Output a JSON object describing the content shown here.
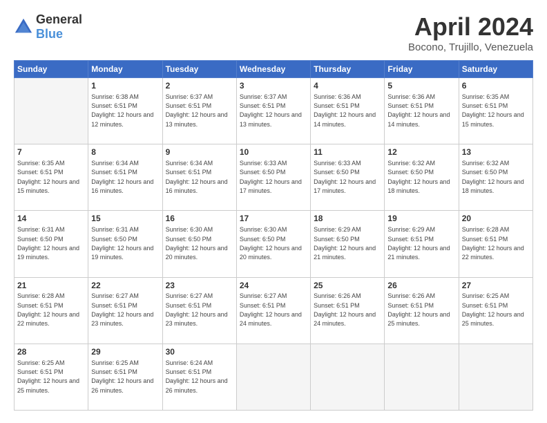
{
  "header": {
    "logo_general": "General",
    "logo_blue": "Blue",
    "title": "April 2024",
    "location": "Bocono, Trujillo, Venezuela"
  },
  "days_of_week": [
    "Sunday",
    "Monday",
    "Tuesday",
    "Wednesday",
    "Thursday",
    "Friday",
    "Saturday"
  ],
  "weeks": [
    [
      {
        "num": "",
        "empty": true
      },
      {
        "num": "1",
        "sunrise": "6:38 AM",
        "sunset": "6:51 PM",
        "daylight": "12 hours and 12 minutes."
      },
      {
        "num": "2",
        "sunrise": "6:37 AM",
        "sunset": "6:51 PM",
        "daylight": "12 hours and 13 minutes."
      },
      {
        "num": "3",
        "sunrise": "6:37 AM",
        "sunset": "6:51 PM",
        "daylight": "12 hours and 13 minutes."
      },
      {
        "num": "4",
        "sunrise": "6:36 AM",
        "sunset": "6:51 PM",
        "daylight": "12 hours and 14 minutes."
      },
      {
        "num": "5",
        "sunrise": "6:36 AM",
        "sunset": "6:51 PM",
        "daylight": "12 hours and 14 minutes."
      },
      {
        "num": "6",
        "sunrise": "6:35 AM",
        "sunset": "6:51 PM",
        "daylight": "12 hours and 15 minutes."
      }
    ],
    [
      {
        "num": "7",
        "sunrise": "6:35 AM",
        "sunset": "6:51 PM",
        "daylight": "12 hours and 15 minutes."
      },
      {
        "num": "8",
        "sunrise": "6:34 AM",
        "sunset": "6:51 PM",
        "daylight": "12 hours and 16 minutes."
      },
      {
        "num": "9",
        "sunrise": "6:34 AM",
        "sunset": "6:51 PM",
        "daylight": "12 hours and 16 minutes."
      },
      {
        "num": "10",
        "sunrise": "6:33 AM",
        "sunset": "6:50 PM",
        "daylight": "12 hours and 17 minutes."
      },
      {
        "num": "11",
        "sunrise": "6:33 AM",
        "sunset": "6:50 PM",
        "daylight": "12 hours and 17 minutes."
      },
      {
        "num": "12",
        "sunrise": "6:32 AM",
        "sunset": "6:50 PM",
        "daylight": "12 hours and 18 minutes."
      },
      {
        "num": "13",
        "sunrise": "6:32 AM",
        "sunset": "6:50 PM",
        "daylight": "12 hours and 18 minutes."
      }
    ],
    [
      {
        "num": "14",
        "sunrise": "6:31 AM",
        "sunset": "6:50 PM",
        "daylight": "12 hours and 19 minutes."
      },
      {
        "num": "15",
        "sunrise": "6:31 AM",
        "sunset": "6:50 PM",
        "daylight": "12 hours and 19 minutes."
      },
      {
        "num": "16",
        "sunrise": "6:30 AM",
        "sunset": "6:50 PM",
        "daylight": "12 hours and 20 minutes."
      },
      {
        "num": "17",
        "sunrise": "6:30 AM",
        "sunset": "6:50 PM",
        "daylight": "12 hours and 20 minutes."
      },
      {
        "num": "18",
        "sunrise": "6:29 AM",
        "sunset": "6:50 PM",
        "daylight": "12 hours and 21 minutes."
      },
      {
        "num": "19",
        "sunrise": "6:29 AM",
        "sunset": "6:51 PM",
        "daylight": "12 hours and 21 minutes."
      },
      {
        "num": "20",
        "sunrise": "6:28 AM",
        "sunset": "6:51 PM",
        "daylight": "12 hours and 22 minutes."
      }
    ],
    [
      {
        "num": "21",
        "sunrise": "6:28 AM",
        "sunset": "6:51 PM",
        "daylight": "12 hours and 22 minutes."
      },
      {
        "num": "22",
        "sunrise": "6:27 AM",
        "sunset": "6:51 PM",
        "daylight": "12 hours and 23 minutes."
      },
      {
        "num": "23",
        "sunrise": "6:27 AM",
        "sunset": "6:51 PM",
        "daylight": "12 hours and 23 minutes."
      },
      {
        "num": "24",
        "sunrise": "6:27 AM",
        "sunset": "6:51 PM",
        "daylight": "12 hours and 24 minutes."
      },
      {
        "num": "25",
        "sunrise": "6:26 AM",
        "sunset": "6:51 PM",
        "daylight": "12 hours and 24 minutes."
      },
      {
        "num": "26",
        "sunrise": "6:26 AM",
        "sunset": "6:51 PM",
        "daylight": "12 hours and 25 minutes."
      },
      {
        "num": "27",
        "sunrise": "6:25 AM",
        "sunset": "6:51 PM",
        "daylight": "12 hours and 25 minutes."
      }
    ],
    [
      {
        "num": "28",
        "sunrise": "6:25 AM",
        "sunset": "6:51 PM",
        "daylight": "12 hours and 25 minutes."
      },
      {
        "num": "29",
        "sunrise": "6:25 AM",
        "sunset": "6:51 PM",
        "daylight": "12 hours and 26 minutes."
      },
      {
        "num": "30",
        "sunrise": "6:24 AM",
        "sunset": "6:51 PM",
        "daylight": "12 hours and 26 minutes."
      },
      {
        "num": "",
        "empty": true
      },
      {
        "num": "",
        "empty": true
      },
      {
        "num": "",
        "empty": true
      },
      {
        "num": "",
        "empty": true
      }
    ]
  ]
}
